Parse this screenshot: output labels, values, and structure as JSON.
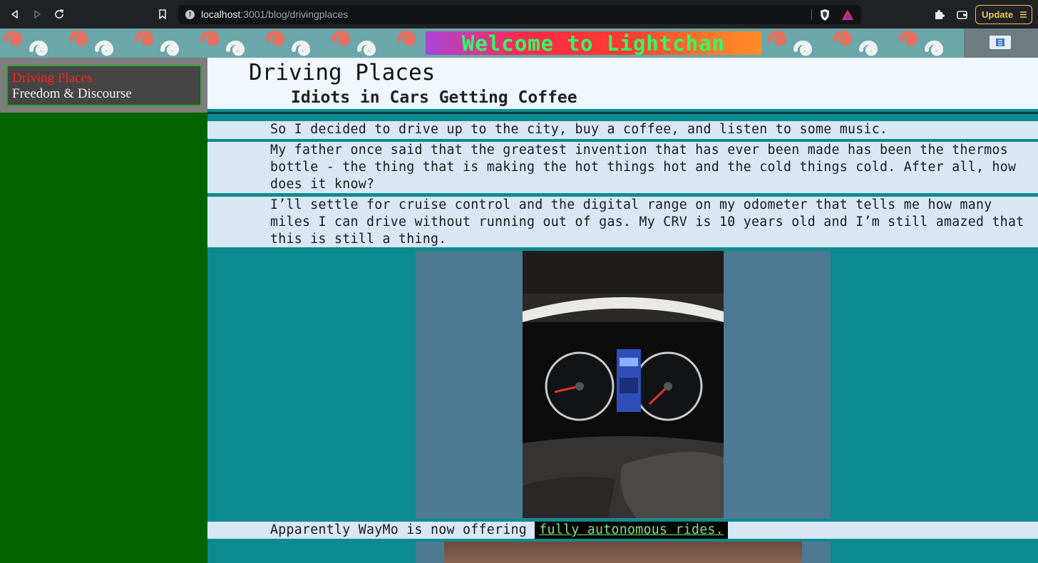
{
  "browser": {
    "url_host": "localhost",
    "url_path": ":3001/blog/drivingplaces",
    "update_label": "Update"
  },
  "banner": {
    "title": "Welcome to Lightchan"
  },
  "sidebar": {
    "items": [
      {
        "label": "Driving Places",
        "color": "#ff2020"
      },
      {
        "label": "Freedom & Discourse",
        "color": "#f2f2f2"
      }
    ]
  },
  "post": {
    "title": "Driving Places",
    "subtitle": "Idiots in Cars Getting Coffee",
    "paragraphs": [
      "So I decided to drive up to the city, buy a coffee, and listen to some music.",
      "My father once said that the greatest invention that has ever been made has been the thermos bottle - the thing that is making the hot things hot and the cold things cold. After all, how does it know?",
      "I’ll settle for cruise control and the digital range on my odometer that tells me how many miles I can drive without running out of gas. My CRV is 10 years old and I’m still amazed that this is still a thing."
    ],
    "waymo_text": "Apparently WayMo is now offering ",
    "waymo_link": "fully autonomous rides."
  },
  "colors": {
    "sidebar_bg": "#006400",
    "main_bg": "#0b8b8f",
    "paragraph_bg": "#d8e6f6",
    "link_color": "#7ee87e"
  }
}
